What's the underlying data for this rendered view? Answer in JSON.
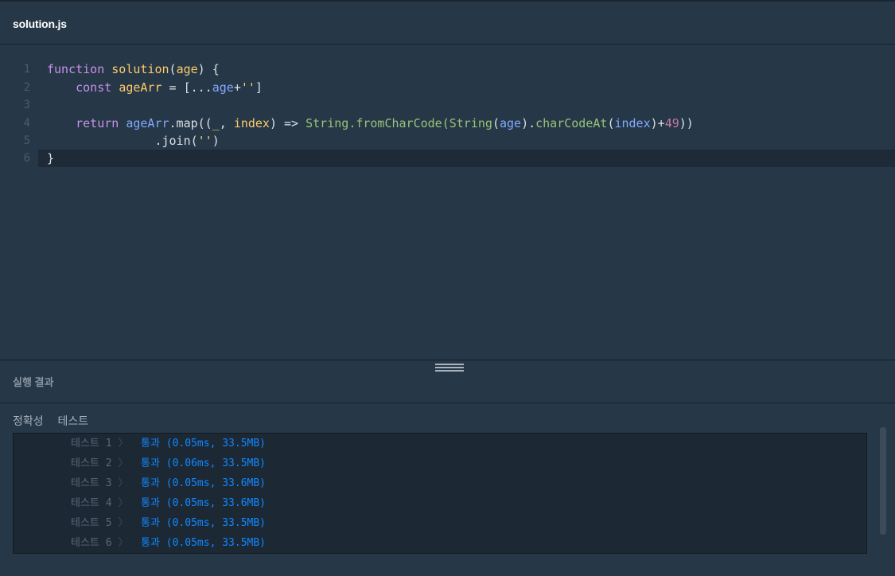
{
  "file": {
    "name": "solution.js"
  },
  "editor": {
    "lines": [
      {
        "num": "1",
        "tokens": [
          {
            "t": "function",
            "c": "kw"
          },
          {
            "t": " ",
            "c": "pln"
          },
          {
            "t": "solution",
            "c": "fn"
          },
          {
            "t": "(",
            "c": "pln"
          },
          {
            "t": "age",
            "c": "prm"
          },
          {
            "t": ") {",
            "c": "pln"
          }
        ]
      },
      {
        "num": "2",
        "tokens": [
          {
            "t": "    ",
            "c": "pln"
          },
          {
            "t": "const",
            "c": "kw"
          },
          {
            "t": " ",
            "c": "pln"
          },
          {
            "t": "ageArr",
            "c": "fn"
          },
          {
            "t": " = [...",
            "c": "pln"
          },
          {
            "t": "age",
            "c": "var"
          },
          {
            "t": "+",
            "c": "pln"
          },
          {
            "t": "''",
            "c": "fn"
          },
          {
            "t": "]",
            "c": "pln"
          }
        ]
      },
      {
        "num": "3",
        "tokens": []
      },
      {
        "num": "4",
        "tokens": [
          {
            "t": "    ",
            "c": "pln"
          },
          {
            "t": "return",
            "c": "kw"
          },
          {
            "t": " ",
            "c": "pln"
          },
          {
            "t": "ageArr",
            "c": "var"
          },
          {
            "t": ".map((",
            "c": "pln"
          },
          {
            "t": "_",
            "c": "fn"
          },
          {
            "t": ", ",
            "c": "pln"
          },
          {
            "t": "index",
            "c": "fn"
          },
          {
            "t": ") => ",
            "c": "pln"
          },
          {
            "t": "String",
            "c": "kgreen"
          },
          {
            "t": ".fromCharCode(",
            "c": "kgreen"
          },
          {
            "t": "String",
            "c": "kgreen"
          },
          {
            "t": "(",
            "c": "pln"
          },
          {
            "t": "age",
            "c": "var"
          },
          {
            "t": ").",
            "c": "pln"
          },
          {
            "t": "charCodeAt",
            "c": "kgreen"
          },
          {
            "t": "(",
            "c": "pln"
          },
          {
            "t": "index",
            "c": "var"
          },
          {
            "t": ")+",
            "c": "pln"
          },
          {
            "t": "49",
            "c": "num2"
          },
          {
            "t": "))",
            "c": "pln"
          }
        ]
      },
      {
        "num": "5",
        "tokens": [
          {
            "t": "               .join(",
            "c": "pln"
          },
          {
            "t": "''",
            "c": "fn"
          },
          {
            "t": ")",
            "c": "pln"
          }
        ]
      },
      {
        "num": "6",
        "tokens": [
          {
            "t": "}",
            "c": "pln"
          }
        ],
        "active": true
      }
    ]
  },
  "results": {
    "title": "실행 결과",
    "tabs": [
      "정확성",
      "테스트"
    ],
    "rows": [
      {
        "label": "테스트 1",
        "sep": "〉",
        "status": "통과 (0.05ms, 33.5MB)"
      },
      {
        "label": "테스트 2",
        "sep": "〉",
        "status": "통과 (0.06ms, 33.5MB)"
      },
      {
        "label": "테스트 3",
        "sep": "〉",
        "status": "통과 (0.05ms, 33.6MB)"
      },
      {
        "label": "테스트 4",
        "sep": "〉",
        "status": "통과 (0.05ms, 33.6MB)"
      },
      {
        "label": "테스트 5",
        "sep": "〉",
        "status": "통과 (0.05ms, 33.5MB)"
      },
      {
        "label": "테스트 6",
        "sep": "〉",
        "status": "통과 (0.05ms, 33.5MB)"
      }
    ]
  }
}
